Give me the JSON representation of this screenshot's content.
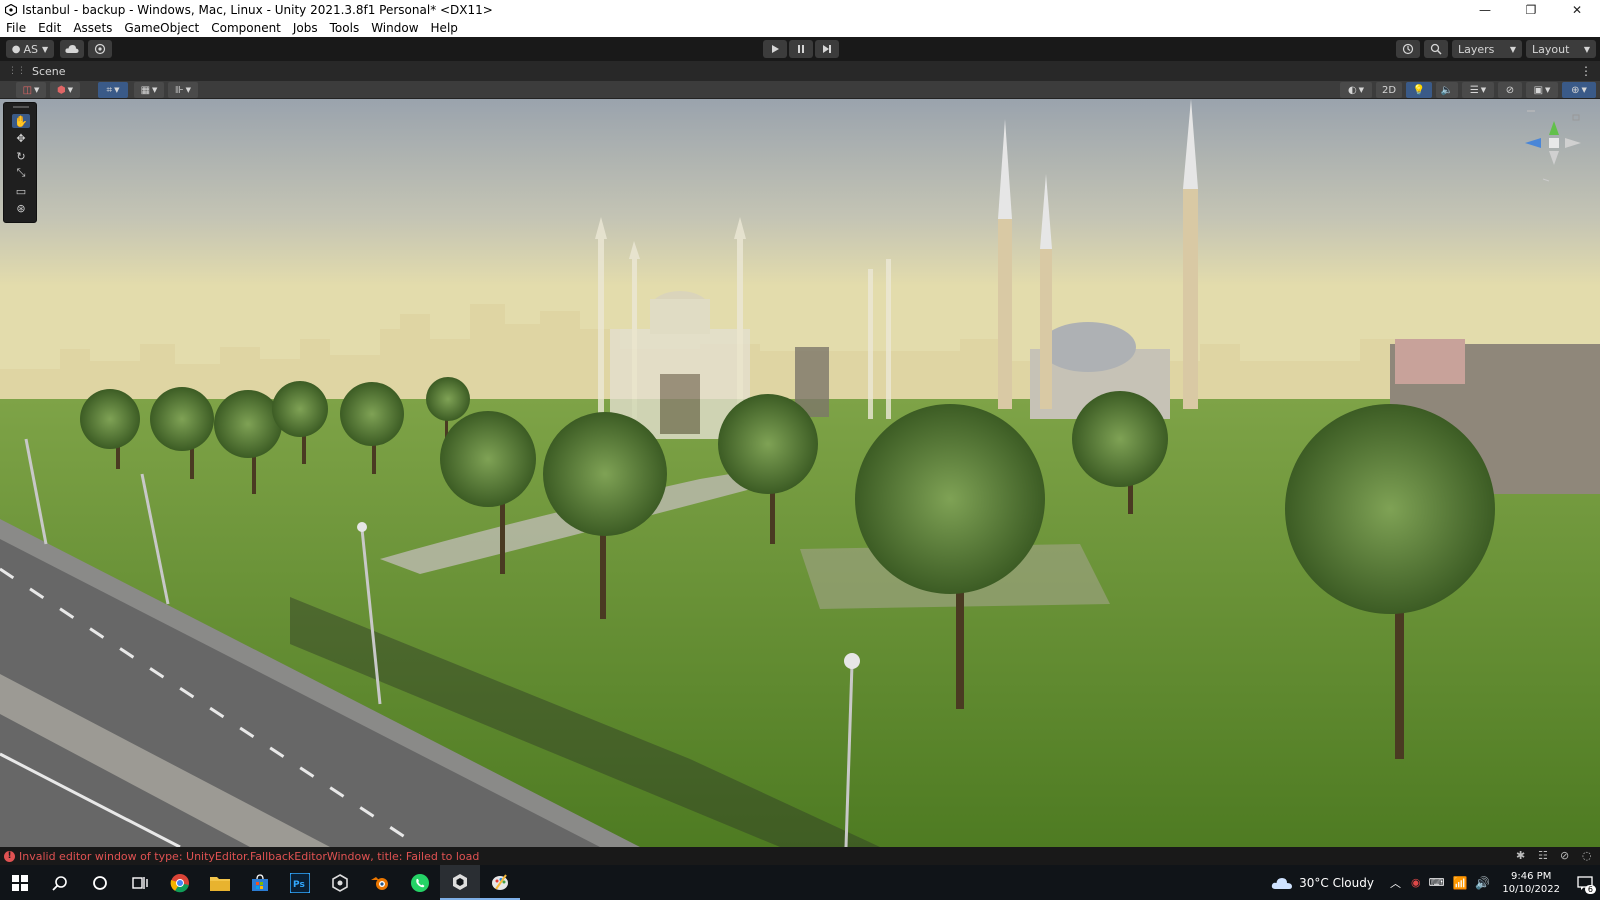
{
  "window": {
    "title": "Istanbul - backup - Windows, Mac, Linux - Unity 2021.3.8f1 Personal* <DX11>",
    "minimize": "—",
    "maximize": "❐",
    "close": "✕"
  },
  "menu": [
    "File",
    "Edit",
    "Assets",
    "GameObject",
    "Component",
    "Jobs",
    "Tools",
    "Window",
    "Help"
  ],
  "toolbar": {
    "account_label": "AS",
    "layers_label": "Layers",
    "layout_label": "Layout"
  },
  "scene_tab": {
    "label": "Scene"
  },
  "scene_toolbar": {
    "mode_2d_label": "2D"
  },
  "status": {
    "message": "Invalid editor window of type: UnityEditor.FallbackEditorWindow, title: Failed to load",
    "error_color": "#e05252"
  },
  "taskbar": {
    "weather": "30°C  Cloudy",
    "time": "9:46 PM",
    "date": "10/10/2022",
    "notification_count": "6"
  },
  "colors": {
    "unity_dark": "#191919",
    "panel": "#3c3c3c",
    "grass": "#5d8a2c",
    "sky_top": "#9aa3ad",
    "sky_horizon": "#e0d8a6"
  }
}
